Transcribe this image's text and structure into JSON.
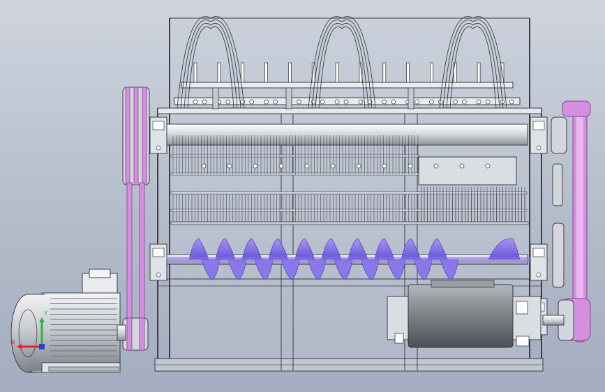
{
  "viewport": {
    "background_top": "#cfd4de",
    "background_bottom": "#a4adbf"
  },
  "colors": {
    "edge": "#3a3f47",
    "steel_light": "#e9ebee",
    "steel_mid": "#c7cbd1",
    "steel_dark": "#6e747c",
    "belt": "#d68ee0",
    "belt_edge": "#7a4a88",
    "flight": "#8a77ea",
    "flight_dark": "#5a48b8",
    "drum": "#8c8f94",
    "triad_x": "#e0252a",
    "triad_y": "#2bb43a",
    "triad_z": "#2741d6"
  },
  "machine": {
    "feed_arches": 3,
    "shaker_bars": 14,
    "auger_turns": 10,
    "motor_fins": 12
  },
  "triad": {
    "x_label": "X",
    "y_label": "Y"
  }
}
